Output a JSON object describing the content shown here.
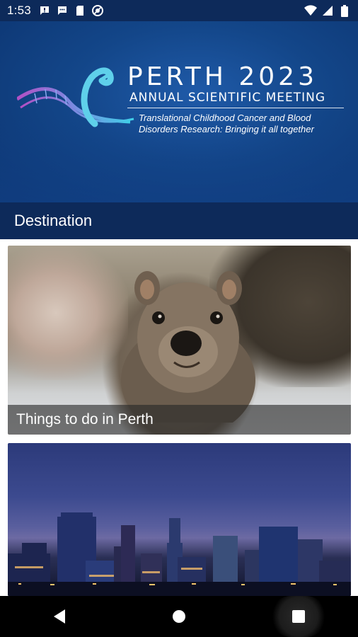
{
  "status_bar": {
    "time": "1:53",
    "left_icons": [
      "message-icon",
      "message-icon",
      "sim-card-icon",
      "do-not-disturb-icon"
    ],
    "right_icons": [
      "wifi-icon",
      "signal-icon",
      "battery-icon"
    ]
  },
  "banner": {
    "title": "PERTH 2023",
    "subtitle": "ANNUAL SCIENTIFIC MEETING",
    "tagline_line1": "Translational Childhood Cancer and Blood",
    "tagline_line2": "Disorders Research: Bringing it all together"
  },
  "section": {
    "title": "Destination"
  },
  "cards": [
    {
      "caption": "Things to do in Perth",
      "image": "quokka-photo"
    },
    {
      "caption": "",
      "image": "perth-skyline-photo"
    }
  ],
  "nav": {
    "back": "back-icon",
    "home": "home-icon",
    "recents": "recents-icon"
  },
  "colors": {
    "primary_dark": "#0d2a5a",
    "banner_blue": "#134689",
    "caption_overlay": "rgba(40,40,40,0.62)"
  }
}
